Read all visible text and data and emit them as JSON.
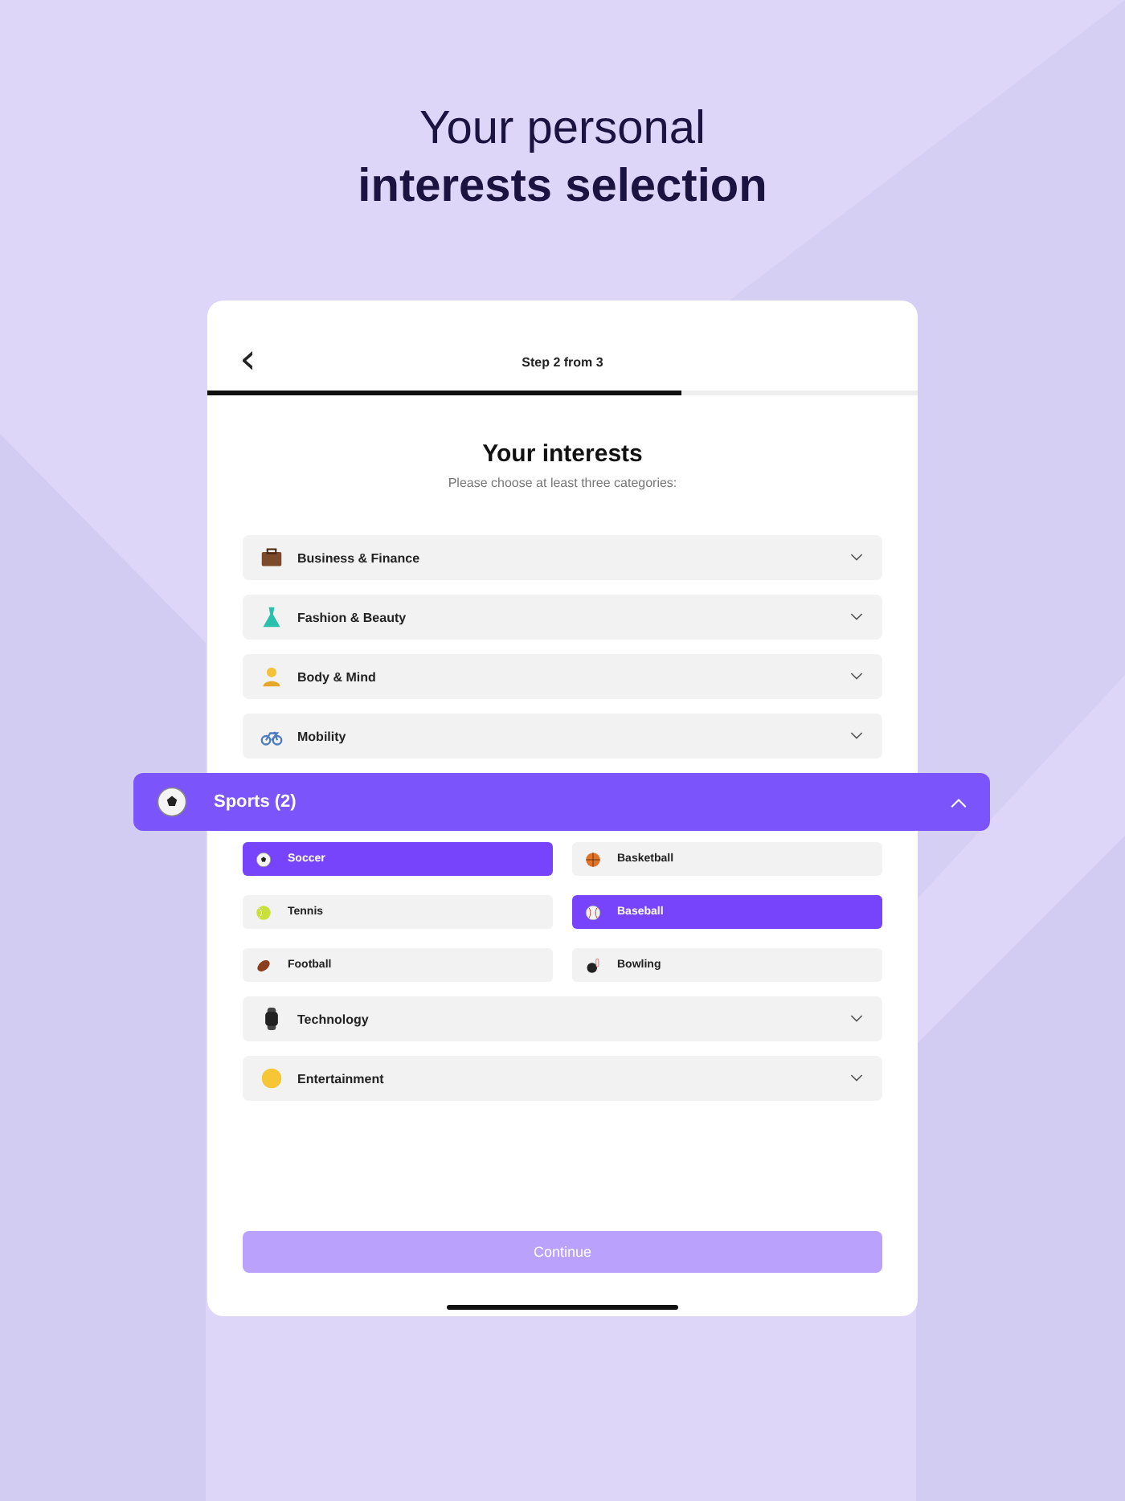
{
  "heading": {
    "line_1": "Your personal",
    "line_2": "interests selection"
  },
  "header": {
    "back": "‹",
    "step": "Step 2 from 3"
  },
  "progress": {
    "level": 0.667
  },
  "title": "Your interests",
  "subtitle": "Please choose at least three categories:",
  "categories": [
    {
      "label": "Business & Finance",
      "expanded": false
    },
    {
      "label": "Fashion & Beauty",
      "expanded": false
    },
    {
      "label": "Body & Mind",
      "expanded": false
    },
    {
      "label": "Mobility",
      "expanded": false
    },
    {
      "label": "Sports (2)",
      "expanded": true,
      "options": [
        {
          "label": "Soccer",
          "selected": true
        },
        {
          "label": "Basketball",
          "selected": false
        },
        {
          "label": "Tennis",
          "selected": false
        },
        {
          "label": "Baseball",
          "selected": true
        },
        {
          "label": "Football",
          "selected": false
        },
        {
          "label": "Bowling",
          "selected": false
        }
      ]
    },
    {
      "label": "Technology",
      "expanded": false
    },
    {
      "label": "Entertainment",
      "expanded": false
    }
  ],
  "continue_button": {
    "label": "Continue",
    "disabled": true
  }
}
